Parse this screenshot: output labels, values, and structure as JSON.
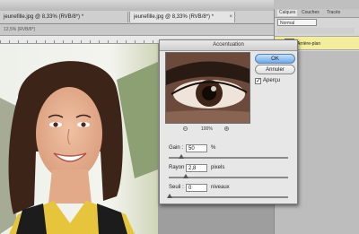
{
  "tabs": [
    {
      "label": "jeunefille.jpg @ 8,33% (RVB/8*) *"
    },
    {
      "label": "jeunefille.jpg @ 8,33% (RVB/8*) *",
      "close": "×"
    }
  ],
  "subtab_info": "12,5% (RVB/8*)   ",
  "panel": {
    "tabs": [
      "Calques",
      "Couches",
      "Tracés"
    ],
    "blend_mode": "Normal",
    "layer_name": "Arrière-plan"
  },
  "dialog": {
    "title": "Accentuation",
    "ok": "OK",
    "cancel": "Annuler",
    "preview_label": "Aperçu",
    "preview_checked": "✓",
    "zoom": "100%",
    "zoom_out": "−",
    "zoom_in": "+",
    "gain": {
      "label": "Gain :",
      "value": "50",
      "unit": "%",
      "level": 0.1
    },
    "rayon": {
      "label": "Rayon :",
      "value": "2,8",
      "unit": "pixels",
      "level": 0.14
    },
    "seuil": {
      "label": "Seuil :",
      "value": "0",
      "unit": "niveaux",
      "level": 0.0
    }
  }
}
